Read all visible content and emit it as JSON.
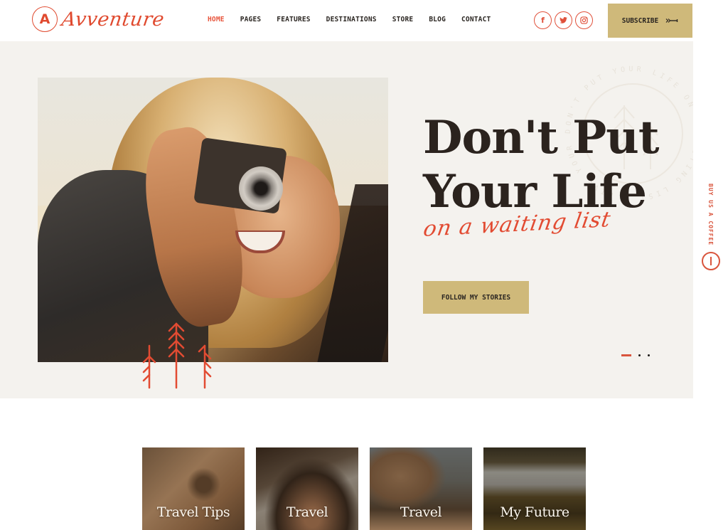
{
  "header": {
    "logo_letter": "A",
    "logo_text": "Avventure",
    "nav": [
      {
        "label": "HOME",
        "active": true
      },
      {
        "label": "PAGES",
        "active": false
      },
      {
        "label": "FEATURES",
        "active": false
      },
      {
        "label": "DESTINATIONS",
        "active": false
      },
      {
        "label": "STORE",
        "active": false
      },
      {
        "label": "BLOG",
        "active": false
      },
      {
        "label": "CONTACT",
        "active": false
      }
    ],
    "socials": [
      {
        "icon": "facebook-icon",
        "glyph": "f"
      },
      {
        "icon": "twitter-icon",
        "glyph": "🐦"
      },
      {
        "icon": "instagram-icon",
        "glyph": "◎"
      }
    ],
    "subscribe_label": "SUBSCRIBE",
    "subscribe_icon": "arrow-right-icon"
  },
  "hero": {
    "title_line1": "Don't Put",
    "title_line2": "Your Life",
    "script_text": "on a waiting list",
    "stamp_text": "DON'T PUT YOUR LIFE ON A WAITING LIST · LIVE YOUR LIFE",
    "cta_label": "FOLLOW MY STORIES",
    "slider": {
      "total": 3,
      "active": 1
    }
  },
  "side_tab": {
    "label": "BUY US A COFFEE",
    "icon": "coffee-icon"
  },
  "categories": [
    {
      "title": "Travel Tips"
    },
    {
      "title": "Travel"
    },
    {
      "title": "Travel"
    },
    {
      "title": "My Future"
    }
  ],
  "colors": {
    "accent": "#e24b32",
    "gold": "#cfb97a",
    "hero_bg": "#f4f2ee",
    "text_dark": "#2b231e"
  }
}
